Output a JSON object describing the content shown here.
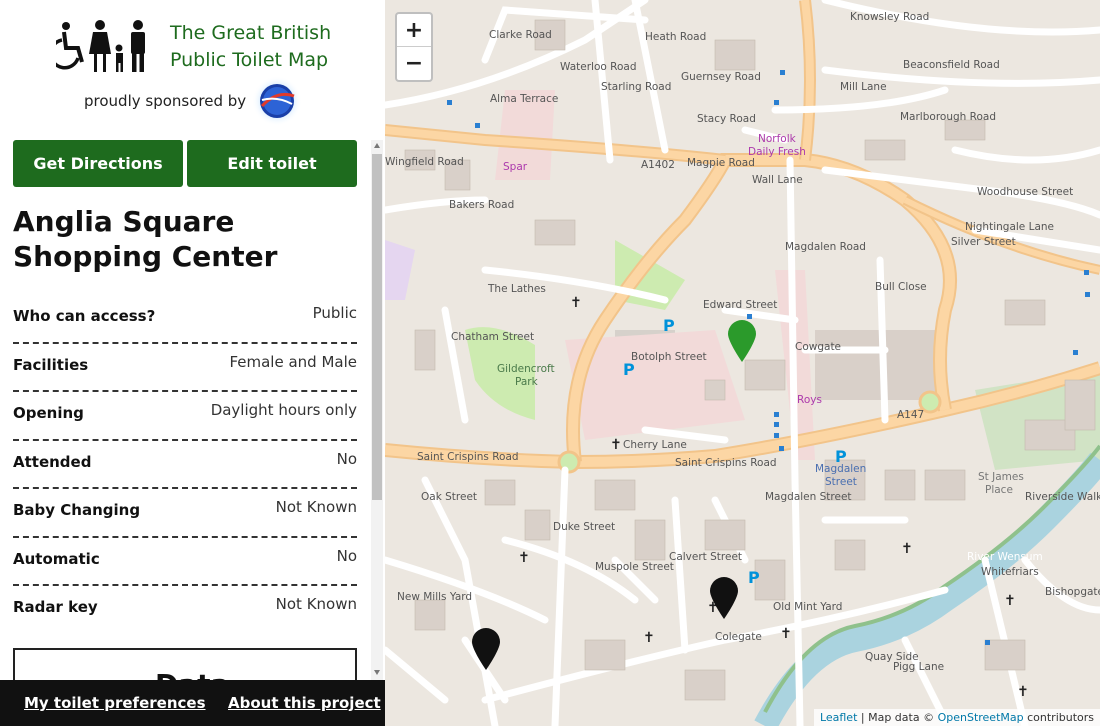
{
  "site": {
    "title_line1": "The Great British",
    "title_line2": "Public Toilet Map",
    "sponsor_text": "proudly sponsored by",
    "sponsor_logo": "domestos-logo"
  },
  "actions": {
    "directions": "Get Directions",
    "edit": "Edit toilet"
  },
  "toilet": {
    "name": "Anglia Square Shopping Center",
    "properties": [
      {
        "label": "Who can access?",
        "value": "Public"
      },
      {
        "label": "Facilities",
        "value": "Female and Male"
      },
      {
        "label": "Opening",
        "value": "Daylight hours only"
      },
      {
        "label": "Attended",
        "value": "No"
      },
      {
        "label": "Baby Changing",
        "value": "Not Known"
      },
      {
        "label": "Automatic",
        "value": "No"
      },
      {
        "label": "Radar key",
        "value": "Not Known"
      }
    ],
    "data_heading": "Data"
  },
  "footer": {
    "preferences": "My toilet preferences",
    "about": "About this project"
  },
  "map": {
    "zoom_in": "+",
    "zoom_out": "−",
    "attribution": {
      "leaflet": "Leaflet",
      "sep": " | Map data © ",
      "osm": "OpenStreetMap",
      "suffix": " contributors"
    },
    "labels": {
      "clarke_road": "Clarke Road",
      "knowsley_road": "Knowsley Road",
      "beaconsfield_road": "Beaconsfield Road",
      "guernsey_road": "Guernsey Road",
      "mill_lane": "Mill Lane",
      "marlborough_road": "Marlborough Road",
      "stacy_road": "Stacy Road",
      "alma_terrace": "Alma Terrace",
      "magpie_road": "Magpie Road",
      "a1402": "A1402",
      "wall_lane": "Wall Lane",
      "norfolk_daily_fresh_1": "Norfolk",
      "norfolk_daily_fresh_2": "Daily Fresh",
      "spar": "Spar",
      "bakers_road": "Bakers Road",
      "wingfield_road": "Wingfield Road",
      "woodhouse_street": "Woodhouse Street",
      "nightingale_lane": "Nightingale Lane",
      "silver_street": "Silver Street",
      "the_lathes": "The Lathes",
      "edward_street": "Edward Street",
      "cowgate": "Cowgate",
      "gildencroft_park_1": "Gildencroft",
      "gildencroft_park_2": "Park",
      "roys": "Roys",
      "a147": "A147",
      "cherry_lane": "Cherry Lane",
      "saint_crispins_road_1": "Saint Crispins Road",
      "saint_crispins_road_2": "Saint Crispins Road",
      "magdalen_street_1": "Magdalen",
      "magdalen_street_2": "Street",
      "st_james_place_1": "St James",
      "st_james_place_2": "Place",
      "old_mint_yard": "Old Mint Yard",
      "colegate": "Colegate",
      "new_mills_yard": "New Mills Yard",
      "muspole_street": "Muspole Street",
      "duke_street": "Duke Street",
      "quay_side": "Quay Side",
      "bishopgate": "Bishopgate",
      "river_wensum": "River Wensum",
      "riverside_walk": "Riverside Walk",
      "oak_street": "Oak Street",
      "chatham_street": "Chatham Street",
      "botolph_street": "Botolph Street",
      "calvert_street": "Calvert Street",
      "magdalen_street_v": "Magdalen Street",
      "heath_road": "Heath Road",
      "waterloo_road": "Waterloo Road",
      "starling_road": "Starling Road",
      "bull_close": "Bull Close",
      "whitefriars": "Whitefriars",
      "pigg_lane": "Pigg Lane",
      "magdalen_road": "Magdalen Road"
    }
  }
}
